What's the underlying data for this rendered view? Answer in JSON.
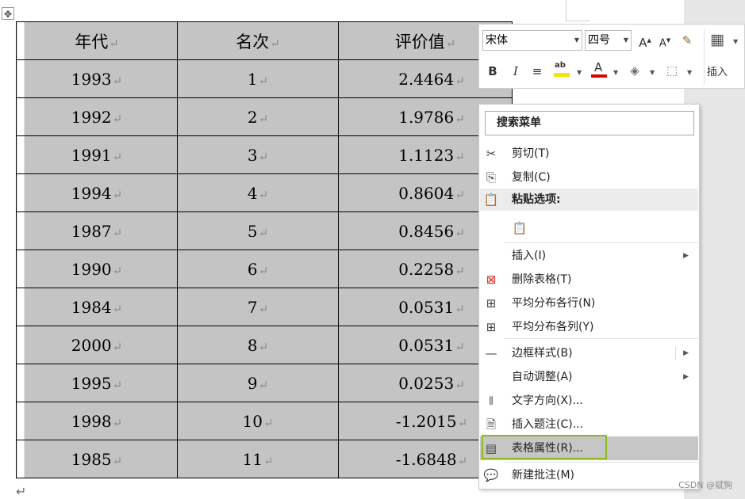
{
  "table": {
    "headers": [
      "年代",
      "名次",
      "评价值"
    ],
    "rows": [
      [
        "1993",
        "1",
        "2.4464"
      ],
      [
        "1992",
        "2",
        "1.9786"
      ],
      [
        "1991",
        "3",
        "1.1123"
      ],
      [
        "1994",
        "4",
        "0.8604"
      ],
      [
        "1987",
        "5",
        "0.8456"
      ],
      [
        "1990",
        "6",
        "0.2258"
      ],
      [
        "1984",
        "7",
        "0.0531"
      ],
      [
        "2000",
        "8",
        "0.0531"
      ],
      [
        "1995",
        "9",
        "0.0253"
      ],
      [
        "1998",
        "10",
        "-1.2015"
      ],
      [
        "1985",
        "11",
        "-1.6848"
      ]
    ],
    "cell_mark": "↵",
    "paragraph_mark": "↵"
  },
  "toolbar": {
    "font_name": "宋体",
    "font_size": "四号",
    "grow_font": "A",
    "shrink_font": "A",
    "bold": "B",
    "italic": "I",
    "highlight_label": "ab",
    "font_color_label": "A",
    "insert_label": "插入"
  },
  "menu": {
    "search": "搜索菜单",
    "cut": "剪切(T)",
    "copy": "复制(C)",
    "paste_options": "粘贴选项:",
    "insert": "插入(I)",
    "delete_table": "删除表格(T)",
    "distribute_rows": "平均分布各行(N)",
    "distribute_cols": "平均分布各列(Y)",
    "border_styles": "边框样式(B)",
    "autofit": "自动调整(A)",
    "text_direction": "文字方向(X)...",
    "insert_caption": "插入题注(C)...",
    "table_properties": "表格属性(R)...",
    "new_comment": "新建批注(M)"
  },
  "watermark": "CSDN @斌狗",
  "colors": {
    "table_fill": "#c4c4c4",
    "menu_highlight": "#c6c6c6",
    "highlight_border": "#8cb820",
    "font_color_bar": "#e00000",
    "highlighter_bar": "#f4e300"
  }
}
